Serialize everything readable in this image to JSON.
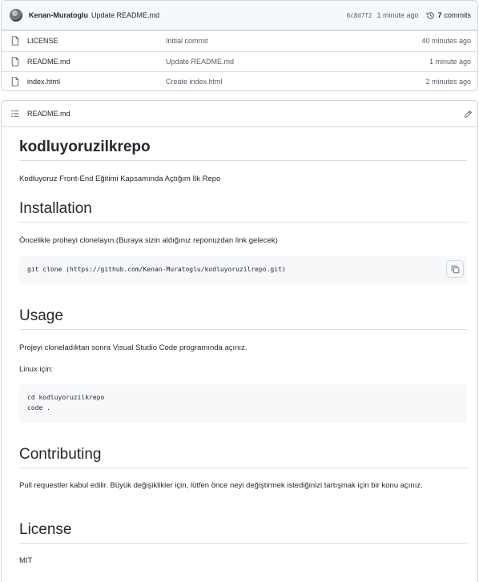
{
  "commit": {
    "author": "Kenan-Muratoglu",
    "message": "Update README.md",
    "sha": "6c8d7f2",
    "time": "1 minute ago",
    "commits_count": "7",
    "commits_label": "commits"
  },
  "files": [
    {
      "name": "LICENSE",
      "message": "Initial commit",
      "time": "40 minutes ago"
    },
    {
      "name": "README.md",
      "message": "Update README.md",
      "time": "1 minute ago"
    },
    {
      "name": "index.html",
      "message": "Create index.html",
      "time": "2 minutes ago"
    }
  ],
  "readme": {
    "filename": "README.md",
    "title": "kodluyoruzilkrepo",
    "description": "Kodluyoruz Front-End Eğitimi Kapsamında Açtığım İlk Repo",
    "installation": {
      "heading": "Installation",
      "text": "Öncelikle proheyi clonelayın.(Buraya sizin aldığınız reponuzdan link gelecek)",
      "code": "git clone (https://github.com/Kenan-Muratoglu/kodluyoruzilrepo.git)"
    },
    "usage": {
      "heading": "Usage",
      "text": "Projeyi cloneladıktan sonra Visual Studio Code programında açınız.",
      "linux_label": "Linux için:",
      "code_line1": "cd kodluyoruzilkrepo",
      "code_line2": "code ."
    },
    "contributing": {
      "heading": "Contributing",
      "text": "Pull requestler kabul edilir. Büyük değişiklikler için, lütfen önce neyi değiştirmek istediğinizi tartışmak için bir konu açınız."
    },
    "license": {
      "heading": "License",
      "link": "MIT"
    }
  }
}
